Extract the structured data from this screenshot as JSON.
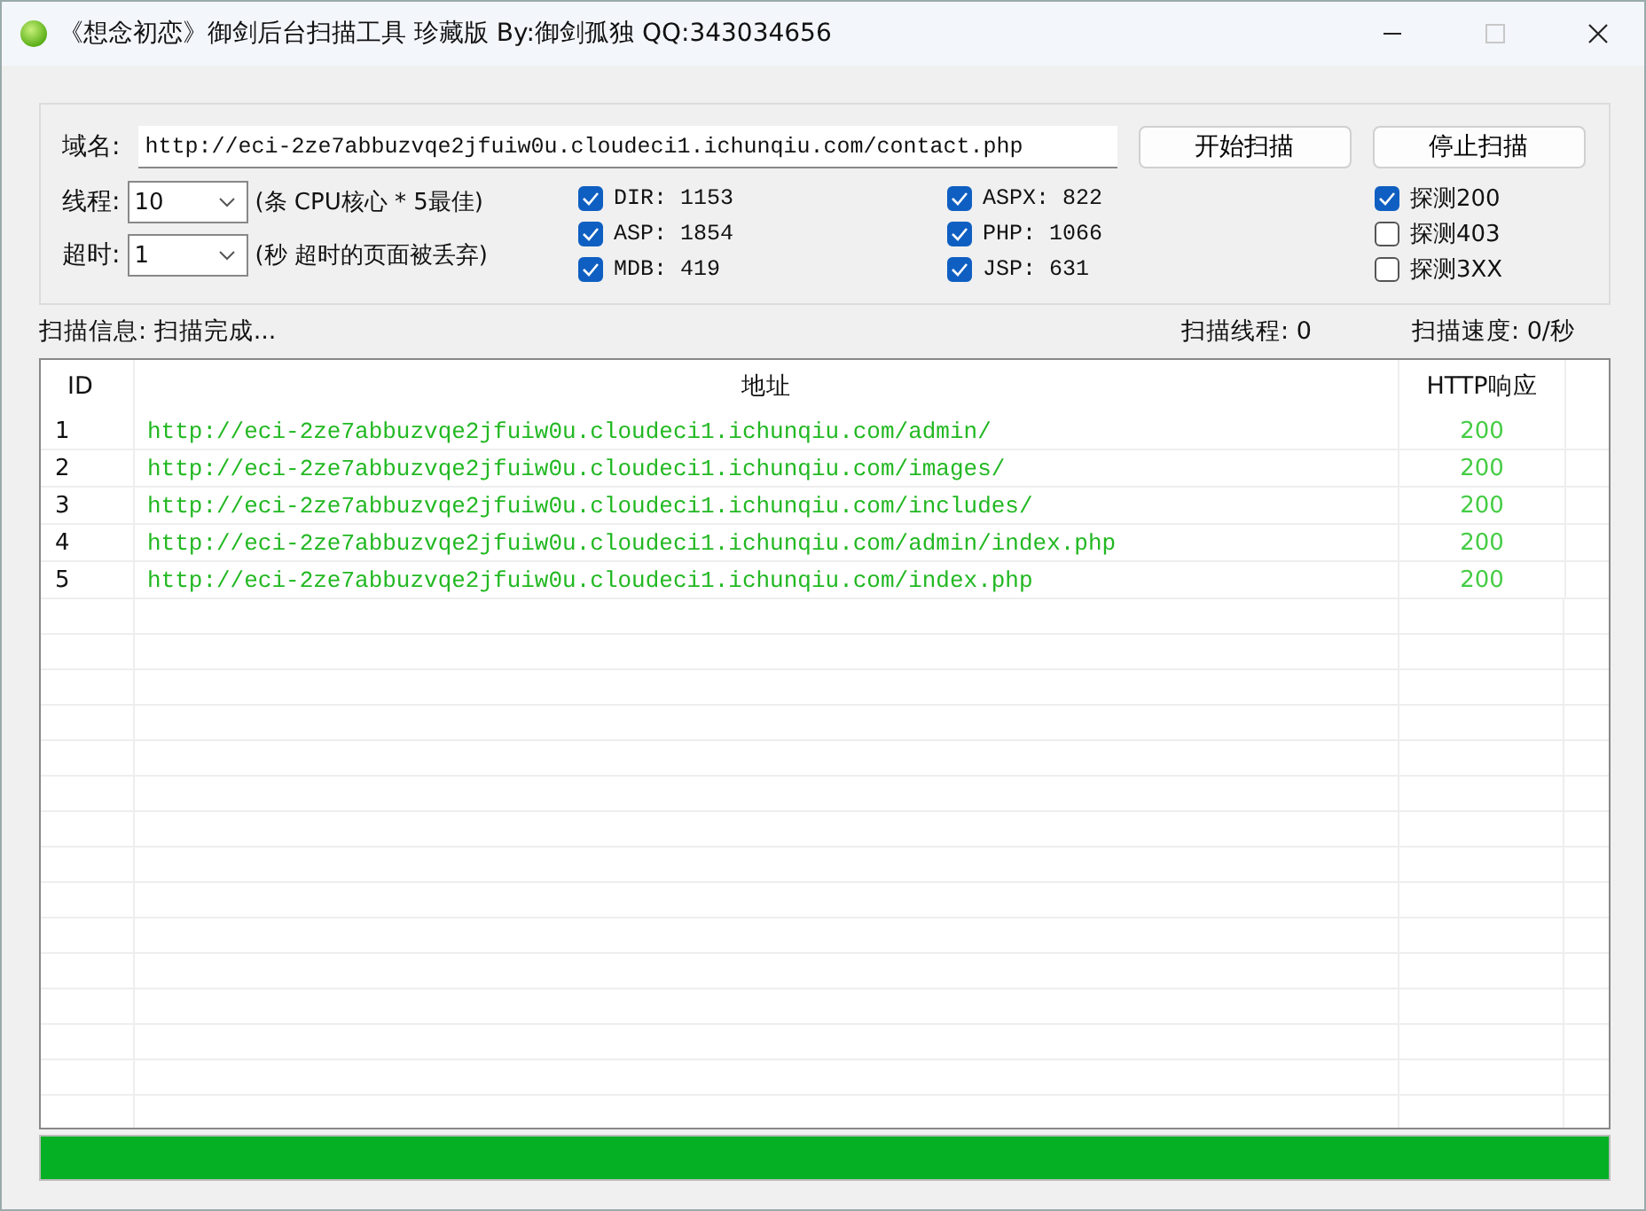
{
  "window": {
    "title": "《想念初恋》御剑后台扫描工具 珍藏版 By:御剑孤独 QQ:343034656",
    "maximize_disabled": true
  },
  "domain": {
    "label": "域名:",
    "value": "http://eci-2ze7abbuzvqe2jfuiw0u.cloudeci1.ichunqiu.com/contact.php"
  },
  "buttons": [
    "开始扫描",
    "停止扫描"
  ],
  "threads": {
    "label": "线程:",
    "value": "10",
    "hint": "(条 CPU核心 * 5最佳)"
  },
  "timeout": {
    "label": "超时:",
    "value": "1",
    "hint": "(秒 超时的页面被丢弃)"
  },
  "dictionaries": [
    [
      {
        "label": "DIR: 1153",
        "checked": true
      },
      {
        "label": "ASP: 1854",
        "checked": true
      },
      {
        "label": "MDB: 419",
        "checked": true
      }
    ],
    [
      {
        "label": "ASPX: 822",
        "checked": true
      },
      {
        "label": "PHP: 1066",
        "checked": true
      },
      {
        "label": "JSP: 631",
        "checked": true
      }
    ]
  ],
  "probes": [
    {
      "label": "探测200",
      "checked": true
    },
    {
      "label": "探测403",
      "checked": false
    },
    {
      "label": "探测3XX",
      "checked": false
    }
  ],
  "status": {
    "info": "扫描信息: 扫描完成...",
    "threads": "扫描线程: 0",
    "speed": "扫描速度: 0/秒"
  },
  "table": {
    "columns": [
      "ID",
      "地址",
      "HTTP响应"
    ],
    "rows": [
      [
        "1",
        "http://eci-2ze7abbuzvqe2jfuiw0u.cloudeci1.ichunqiu.com/admin/",
        "200"
      ],
      [
        "2",
        "http://eci-2ze7abbuzvqe2jfuiw0u.cloudeci1.ichunqiu.com/images/",
        "200"
      ],
      [
        "3",
        "http://eci-2ze7abbuzvqe2jfuiw0u.cloudeci1.ichunqiu.com/includes/",
        "200"
      ],
      [
        "4",
        "http://eci-2ze7abbuzvqe2jfuiw0u.cloudeci1.ichunqiu.com/admin/index.php",
        "200"
      ],
      [
        "5",
        "http://eci-2ze7abbuzvqe2jfuiw0u.cloudeci1.ichunqiu.com/index.php",
        "200"
      ]
    ]
  },
  "progress": {
    "level": 1
  }
}
